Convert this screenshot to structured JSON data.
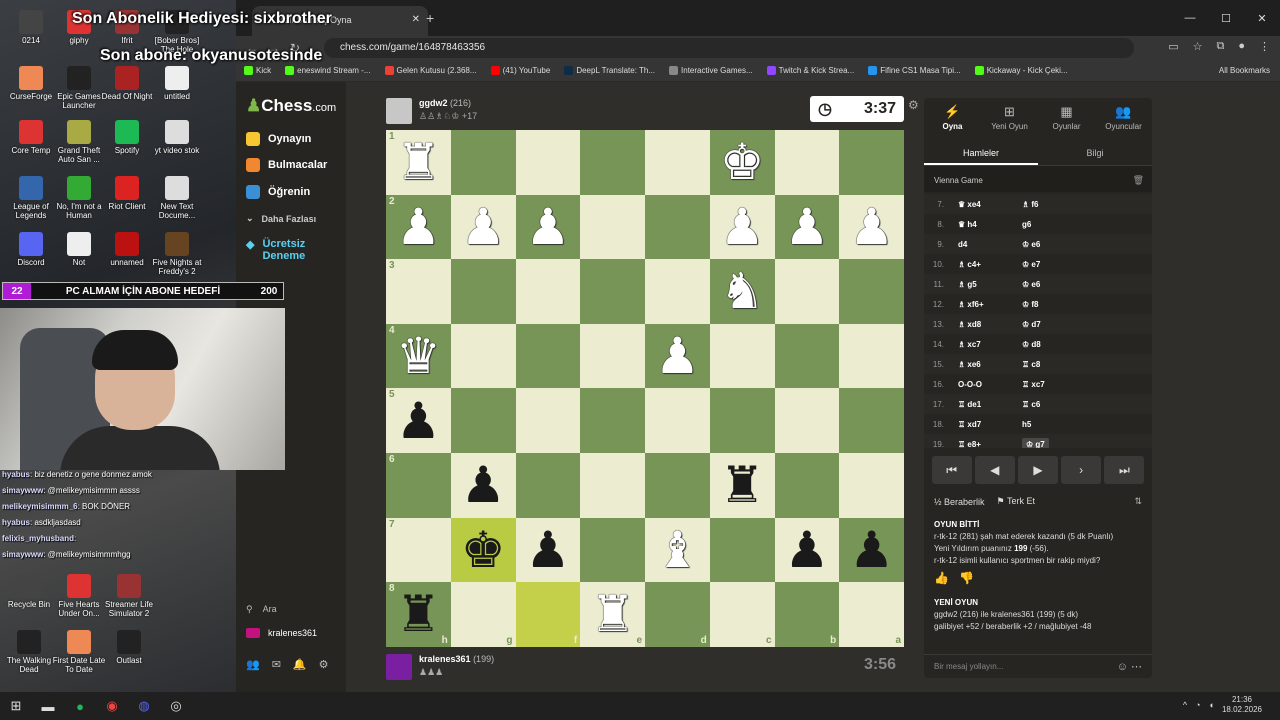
{
  "overlay": {
    "gift_text": "Son Abonelik Hediyesi: sixbrother",
    "sub_text": "Son abone: okyanusotesinde",
    "goal": {
      "current": "22",
      "label": "PC ALMAM İÇİN ABONE HEDEFİ",
      "target": "200"
    }
  },
  "desktop_icons": [
    {
      "label": "0214"
    },
    {
      "label": "giphy"
    },
    {
      "label": "Ifrit"
    },
    {
      "label": "[Bober Bros] The Hole"
    },
    {
      "label": "CurseForge"
    },
    {
      "label": "Epic Games Launcher"
    },
    {
      "label": "Dead Of Night"
    },
    {
      "label": "untitled"
    },
    {
      "label": "Core Temp"
    },
    {
      "label": "Grand Theft Auto San ..."
    },
    {
      "label": "Spotify"
    },
    {
      "label": "yt video stok"
    },
    {
      "label": "League of Legends"
    },
    {
      "label": "No, I'm not a Human"
    },
    {
      "label": "Riot Client"
    },
    {
      "label": "New Text Docume..."
    },
    {
      "label": "Discord"
    },
    {
      "label": "Not"
    },
    {
      "label": "unnamed"
    },
    {
      "label": "Five Nights at Freddy's 2"
    },
    {
      "label": "Recycle Bin"
    },
    {
      "label": "Five Hearts Under On..."
    },
    {
      "label": "Streamer Life Simulator 2"
    },
    {
      "label": "The Walking Dead"
    },
    {
      "label": "First Date Late To Date"
    },
    {
      "label": "Outlast"
    }
  ],
  "chat_overlay": [
    {
      "user": "hyabus",
      "text": ": biz denetiz o gene donmez amok"
    },
    {
      "user": "simaywww",
      "text": ": @melikeymisimmm assss"
    },
    {
      "user": "melikeymisimmm_6",
      "text": ": BOK DÖNER"
    },
    {
      "user": "hyabus",
      "text": ": asdkljasdasd"
    },
    {
      "user": "felixis_myhusband",
      "text": ":"
    },
    {
      "user": "simaywww",
      "text": ": @melikeymisimmmhgg"
    }
  ],
  "browser": {
    "tab_title": "Hızlı Satranç Oyna",
    "new_tab": "+",
    "url": "chess.com/game/164878463356",
    "bookmarks": [
      {
        "label": "Kick",
        "color": "#53fc18"
      },
      {
        "label": "eneswind Stream -...",
        "color": "#53fc18"
      },
      {
        "label": "Gelen Kutusu (2.368...",
        "color": "#ea4335"
      },
      {
        "label": "(41) YouTube",
        "color": "#ff0000"
      },
      {
        "label": "DeepL Translate: Th...",
        "color": "#0f2b46"
      },
      {
        "label": "Interactive Games...",
        "color": "#888888"
      },
      {
        "label": "Twitch & Kick Strea...",
        "color": "#9146ff"
      },
      {
        "label": "Fifine CS1 Masa Tipi...",
        "color": "#2196f3"
      },
      {
        "label": "Kickaway - Kick Çeki...",
        "color": "#53fc18"
      }
    ],
    "all_bookmarks": "All Bookmarks"
  },
  "sidebar": {
    "logo": "Chess",
    "logo_suffix": ".com",
    "items": [
      {
        "label": "Oynayın",
        "color": "#f7c631"
      },
      {
        "label": "Bulmacalar",
        "color": "#f1872f"
      },
      {
        "label": "Öğrenin",
        "color": "#3b8fd4"
      }
    ],
    "more": "Daha Fazlası",
    "premium_1": "Ücretsiz",
    "premium_2": "Deneme",
    "search": "Ara",
    "username": "kralenes361"
  },
  "top_player": {
    "name": "ggdw2",
    "rating": "(216)",
    "captured": "+17",
    "clock": "3:37"
  },
  "bottom_player": {
    "name": "kralenes361",
    "rating": "(199)",
    "clock": "3:56"
  },
  "board": {
    "ranks": [
      "1",
      "2",
      "3",
      "4",
      "5",
      "6",
      "7",
      "8"
    ],
    "files": [
      "h",
      "g",
      "f",
      "e",
      "d",
      "c",
      "b",
      "a"
    ],
    "rows": [
      [
        "wR",
        "",
        "",
        "",
        "",
        "wK",
        "",
        ""
      ],
      [
        "wP",
        "wP",
        "wP",
        "",
        "",
        "wP",
        "wP",
        "wP"
      ],
      [
        "",
        "",
        "",
        "",
        "",
        "wN",
        "",
        ""
      ],
      [
        "wQ",
        "",
        "",
        "",
        "wP",
        "",
        "",
        ""
      ],
      [
        "bP",
        "",
        "",
        "",
        "",
        "",
        "",
        ""
      ],
      [
        "",
        "bP",
        "",
        "",
        "",
        "bR",
        "",
        ""
      ],
      [
        "",
        "bK",
        "bP",
        "",
        "wB",
        "",
        "bP",
        "bP"
      ],
      [
        "bR",
        "",
        "",
        "wR",
        "",
        "",
        "",
        ""
      ]
    ],
    "highlight": [
      "6-1",
      "7-2"
    ]
  },
  "panel": {
    "tabs": [
      {
        "icon": "⚡",
        "label": "Oyna"
      },
      {
        "icon": "⊞",
        "label": "Yeni Oyun"
      },
      {
        "icon": "▦",
        "label": "Oyunlar"
      },
      {
        "icon": "👥",
        "label": "Oyuncular"
      }
    ],
    "subtabs": [
      "Hamleler",
      "Bilgi"
    ],
    "opening": "Vienna Game",
    "moves": [
      {
        "n": "7.",
        "w": "♛ xe4",
        "b": "♗ f6"
      },
      {
        "n": "8.",
        "w": "♛ h4",
        "b": "g6"
      },
      {
        "n": "9.",
        "w": "d4",
        "b": "♔ e6"
      },
      {
        "n": "10.",
        "w": "♗ c4+",
        "b": "♔ e7"
      },
      {
        "n": "11.",
        "w": "♗ g5",
        "b": "♔ e6"
      },
      {
        "n": "12.",
        "w": "♗ xf6+",
        "b": "♔ f8"
      },
      {
        "n": "13.",
        "w": "♗ xd8",
        "b": "♔ d7"
      },
      {
        "n": "14.",
        "w": "♗ xc7",
        "b": "♔ d8"
      },
      {
        "n": "15.",
        "w": "♗ xe6",
        "b": "♖ c8"
      },
      {
        "n": "16.",
        "w": "O-O-O",
        "b": "♖ xc7"
      },
      {
        "n": "17.",
        "w": "♖ de1",
        "b": "♖ c6"
      },
      {
        "n": "18.",
        "w": "♖ xd7",
        "b": "h5"
      },
      {
        "n": "19.",
        "w": "♖ e8+",
        "b": "♔ g7"
      }
    ],
    "draw": "Beraberlik",
    "resign": "Terk Et",
    "result_title": "OYUN BİTTİ",
    "result_line1": "r-tk-12 (281) şah mat ederek kazandı (5 dk Puanlı)",
    "result_line2_a": "Yeni Yıldırım puanınız ",
    "result_line2_b": "199",
    "result_line2_c": " (-56).",
    "result_line3": "r-tk-12 isimli kullanıcı sportmen bir rakip miydi?",
    "new_game_title": "YENİ OYUN",
    "new_game_line1": "ggdw2 (216) ile kralenes361 (199) (5 dk)",
    "new_game_line2": "galibiyet +52 / beraberlik +2 / mağlubiyet -48",
    "message_placeholder": "Bir mesaj yollayın..."
  },
  "taskbar": {
    "time": "21:36",
    "date": "18.02.2026"
  }
}
